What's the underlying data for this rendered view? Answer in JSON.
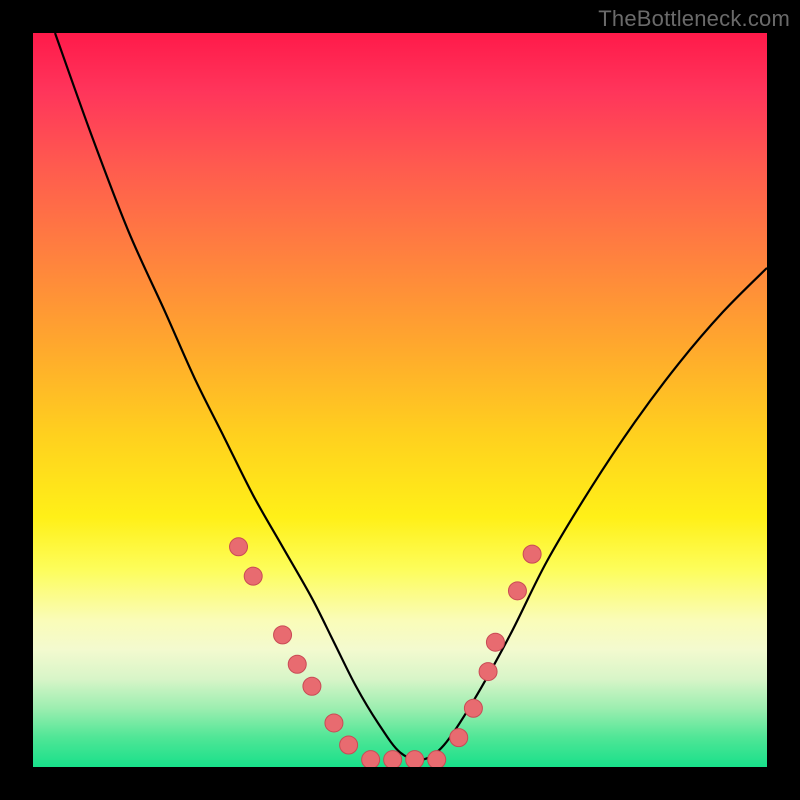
{
  "watermark": "TheBottleneck.com",
  "chart_data": {
    "type": "line",
    "title": "",
    "xlabel": "",
    "ylabel": "",
    "xlim": [
      0,
      100
    ],
    "ylim": [
      0,
      100
    ],
    "gradient_stops": [
      {
        "pos": 0,
        "color": "#ff1a4a"
      },
      {
        "pos": 8,
        "color": "#ff355b"
      },
      {
        "pos": 18,
        "color": "#ff5a4f"
      },
      {
        "pos": 30,
        "color": "#ff803f"
      },
      {
        "pos": 42,
        "color": "#ffa62e"
      },
      {
        "pos": 55,
        "color": "#ffd11e"
      },
      {
        "pos": 66,
        "color": "#fff018"
      },
      {
        "pos": 73,
        "color": "#fdfd5a"
      },
      {
        "pos": 80,
        "color": "#fafcb8"
      },
      {
        "pos": 84,
        "color": "#f3facf"
      },
      {
        "pos": 88,
        "color": "#d8f5c8"
      },
      {
        "pos": 92,
        "color": "#9ceeb0"
      },
      {
        "pos": 96,
        "color": "#4fe696"
      },
      {
        "pos": 100,
        "color": "#18e08a"
      }
    ],
    "series": [
      {
        "name": "bottleneck-curve",
        "x": [
          3,
          8,
          13,
          18,
          22,
          26,
          30,
          34,
          38,
          41,
          44,
          47,
          50,
          53,
          56,
          60,
          65,
          70,
          76,
          82,
          88,
          94,
          100
        ],
        "y": [
          100,
          86,
          73,
          62,
          53,
          45,
          37,
          30,
          23,
          17,
          11,
          6,
          2,
          1,
          3,
          9,
          18,
          28,
          38,
          47,
          55,
          62,
          68
        ]
      }
    ],
    "markers": {
      "name": "highlighted-points",
      "color": "#e86b70",
      "points": [
        {
          "x": 28,
          "y": 30
        },
        {
          "x": 30,
          "y": 26
        },
        {
          "x": 34,
          "y": 18
        },
        {
          "x": 36,
          "y": 14
        },
        {
          "x": 38,
          "y": 11
        },
        {
          "x": 41,
          "y": 6
        },
        {
          "x": 43,
          "y": 3
        },
        {
          "x": 46,
          "y": 1
        },
        {
          "x": 49,
          "y": 1
        },
        {
          "x": 52,
          "y": 1
        },
        {
          "x": 55,
          "y": 1
        },
        {
          "x": 58,
          "y": 4
        },
        {
          "x": 60,
          "y": 8
        },
        {
          "x": 62,
          "y": 13
        },
        {
          "x": 63,
          "y": 17
        },
        {
          "x": 66,
          "y": 24
        },
        {
          "x": 68,
          "y": 29
        }
      ]
    }
  }
}
